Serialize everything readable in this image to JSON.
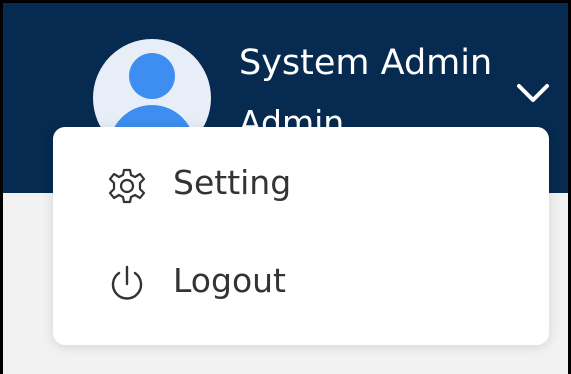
{
  "user_menu": {
    "name": "System Admin",
    "role": "Admin",
    "avatar_icon": "user-avatar-icon",
    "toggle_icon": "chevron-down-icon"
  },
  "dropdown": {
    "items": [
      {
        "label": "Setting",
        "icon": "gear-icon"
      },
      {
        "label": "Logout",
        "icon": "power-icon"
      }
    ]
  },
  "colors": {
    "header_bg": "#062a50",
    "avatar_accent": "#3d8ef0",
    "menu_text": "#333333"
  }
}
